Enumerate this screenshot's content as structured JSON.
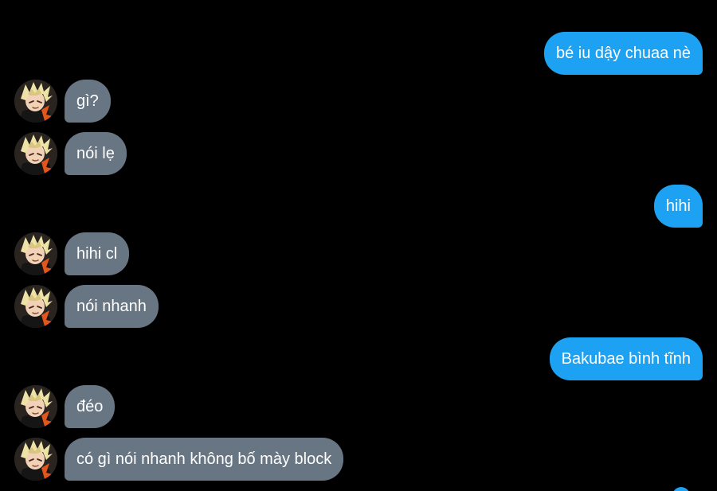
{
  "conversation": {
    "messages": [
      {
        "side": "out",
        "text": "bé iu dậy chuaa nè"
      },
      {
        "side": "in",
        "text": "gì?"
      },
      {
        "side": "in",
        "text": "nói lẹ"
      },
      {
        "side": "out",
        "text": "hihi"
      },
      {
        "side": "in",
        "text": "hihi cl"
      },
      {
        "side": "in",
        "text": "nói nhanh"
      },
      {
        "side": "out",
        "text": "Bakubae bình tĩnh"
      },
      {
        "side": "in",
        "text": "đéo"
      },
      {
        "side": "in",
        "text": "có gì nói nhanh không bố mày block"
      }
    ]
  },
  "contact": {
    "avatar_icon": "contact-avatar-icon"
  },
  "colors": {
    "background": "#000000",
    "outgoing_bubble": "#1da1f2",
    "incoming_bubble": "#687684",
    "text": "#ffffff"
  }
}
